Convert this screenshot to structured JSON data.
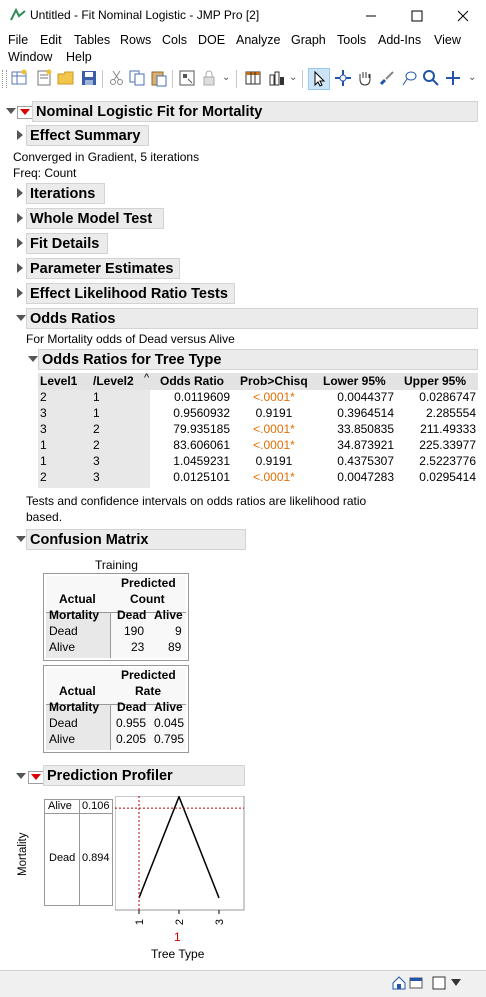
{
  "window": {
    "title": "Untitled - Fit Nominal Logistic - JMP Pro [2]",
    "minimize": "—",
    "maximize": "☐",
    "close": "✕"
  },
  "menu": [
    "File",
    "Edit",
    "Tables",
    "Rows",
    "Cols",
    "DOE",
    "Analyze",
    "Graph",
    "Tools",
    "Add-Ins",
    "View",
    "Window",
    "Help"
  ],
  "report": {
    "main_title": "Nominal Logistic Fit for Mortality",
    "effect_summary": "Effect Summary",
    "converged": "Converged in Gradient, 5 iterations",
    "freq": "Freq: Count",
    "iterations": "Iterations",
    "whole_model": "Whole Model Test",
    "fit_details": "Fit Details",
    "param_estimates": "Parameter Estimates",
    "effect_lr": "Effect Likelihood Ratio Tests",
    "odds_ratios": "Odds Ratios",
    "odds_desc": "For Mortality odds of Dead versus Alive",
    "odds_tree": "Odds Ratios for Tree Type",
    "odds_columns": [
      "Level1",
      "/Level2",
      "Odds Ratio",
      "Prob>Chisq",
      "Lower 95%",
      "Upper 95%"
    ],
    "odds_rows": [
      [
        "2",
        "1",
        "0.0119609",
        "<.0001*",
        "0.0044377",
        "0.0286747"
      ],
      [
        "3",
        "1",
        "0.9560932",
        "0.9191",
        "0.3964514",
        "2.285554"
      ],
      [
        "3",
        "2",
        "79.935185",
        "<.0001*",
        "33.850835",
        "211.49333"
      ],
      [
        "1",
        "2",
        "83.606061",
        "<.0001*",
        "34.873921",
        "225.33977"
      ],
      [
        "1",
        "3",
        "1.0459231",
        "0.9191",
        "0.4375307",
        "2.5223776"
      ],
      [
        "2",
        "3",
        "0.0125101",
        "<.0001*",
        "0.0047283",
        "0.0295414"
      ]
    ],
    "odds_note1": "Tests and confidence intervals on odds ratios are likelihood ratio",
    "odds_note2": "based.",
    "confusion": "Confusion Matrix",
    "training": "Training",
    "predicted": "Predicted",
    "count": "Count",
    "rate": "Rate",
    "actual": "Actual",
    "mortality": "Mortality",
    "dead": "Dead",
    "alive": "Alive",
    "count_vals": {
      "dd": "190",
      "da": "9",
      "ad": "23",
      "aa": "89"
    },
    "rate_vals": {
      "dd": "0.955",
      "da": "0.045",
      "ad": "0.205",
      "aa": "0.795"
    },
    "profiler": "Prediction Profiler",
    "prof_alive_val": "0.106",
    "prof_dead_val": "0.894",
    "prof_ylabel": "Mortality",
    "prof_xlabel": "Tree Type",
    "prof_xticks": [
      "1",
      "2",
      "3"
    ],
    "prof_current": "1"
  },
  "chart_data": {
    "type": "line",
    "x": [
      1,
      2,
      3
    ],
    "y": [
      0.106,
      0.994,
      0.106
    ],
    "xlabel": "Tree Type",
    "ylabel": "Mortality",
    "ylim": [
      0,
      1
    ],
    "current_x": 1,
    "current_y": 0.106
  },
  "colors": {
    "significant": "#e07000",
    "header_bg": "#ebebeb",
    "red_marker": "#d00000"
  }
}
